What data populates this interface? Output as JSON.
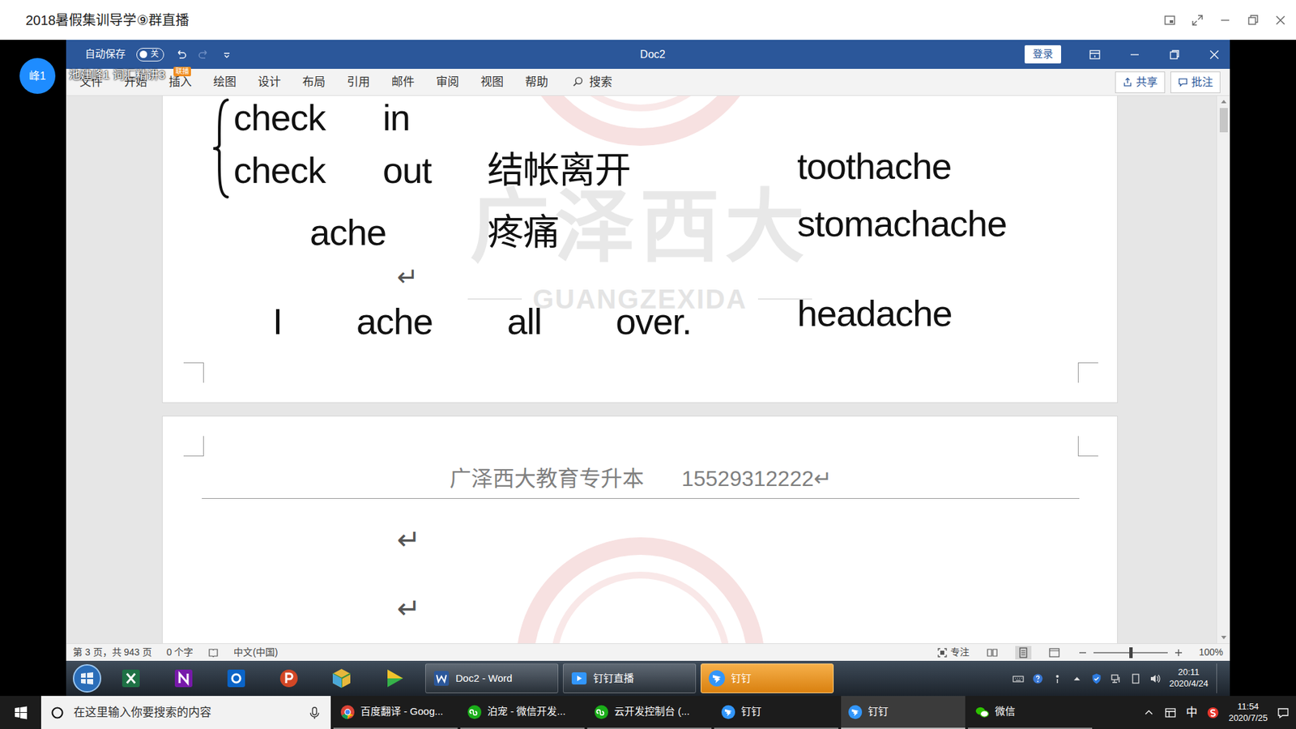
{
  "window": {
    "title": "2018暑假集训导学⑨群直播"
  },
  "presenter": {
    "avatar": "峰1",
    "caption": "池建峰1 词汇精讲3",
    "tag": "联播"
  },
  "word": {
    "autosave": {
      "label": "自动保存",
      "state": "关",
      "on": false
    },
    "title": "Doc2",
    "login": "登录",
    "tabs": [
      {
        "label": "文件",
        "selected": false
      },
      {
        "label": "开始",
        "selected": false
      },
      {
        "label": "插入",
        "selected": false
      },
      {
        "label": "绘图",
        "selected": false
      },
      {
        "label": "设计",
        "selected": false
      },
      {
        "label": "布局",
        "selected": false
      },
      {
        "label": "引用",
        "selected": false
      },
      {
        "label": "邮件",
        "selected": false
      },
      {
        "label": "审阅",
        "selected": false
      },
      {
        "label": "视图",
        "selected": false
      },
      {
        "label": "帮助",
        "selected": false
      }
    ],
    "search": "搜索",
    "share": "共享",
    "comments": "批注"
  },
  "document": {
    "para_mark": "↵",
    "rows": [
      {
        "kind": "phrase",
        "words": [
          "check",
          "in"
        ]
      },
      {
        "kind": "phrase",
        "words": [
          "check",
          "out"
        ],
        "meaning": "结帐离开"
      },
      {
        "kind": "word",
        "words": [
          "ache"
        ],
        "meaning": "疼痛"
      },
      {
        "kind": "mark"
      },
      {
        "kind": "sentence",
        "words": [
          "I",
          "ache",
          "all",
          "over."
        ]
      }
    ],
    "compounds": [
      "toothache",
      "stomachache",
      "headache"
    ],
    "watermark": "广泽西大",
    "watermark_latin": "GUANGZEXIDA",
    "header": {
      "org": "广泽西大教育专升本",
      "phone": "15529312222"
    }
  },
  "status_bar": {
    "page": "第 3 页，共 943 页",
    "words": "0 个字",
    "language": "中文(中国)",
    "focus": "专注",
    "zoom": "100%",
    "zoom_level": 0.5
  },
  "inner_taskbar": {
    "tasks": [
      {
        "label": "Doc2 - Word",
        "selected": false,
        "kind": "word"
      },
      {
        "label": "钉钉直播",
        "selected": false,
        "kind": "dingtalk-live"
      },
      {
        "label": "钉钉",
        "selected": true,
        "kind": "dingtalk"
      }
    ],
    "time": "20:11",
    "date": "2020/4/24"
  },
  "taskbar": {
    "search_placeholder": "在这里输入你要搜索的内容",
    "tasks": [
      {
        "label": "百度翻译 - Goog...",
        "selected": false,
        "kind": "chrome"
      },
      {
        "label": "泊宠 - 微信开发...",
        "selected": false,
        "kind": "wechat-dev"
      },
      {
        "label": "云开发控制台 (...",
        "selected": false,
        "kind": "wechat-dev"
      },
      {
        "label": "钉钉",
        "selected": false,
        "kind": "dingtalk"
      },
      {
        "label": "钉钉",
        "selected": true,
        "kind": "dingtalk"
      },
      {
        "label": "微信",
        "selected": false,
        "kind": "wechat"
      }
    ],
    "ime": "中",
    "time": "11:54",
    "date": "2020/7/25"
  }
}
